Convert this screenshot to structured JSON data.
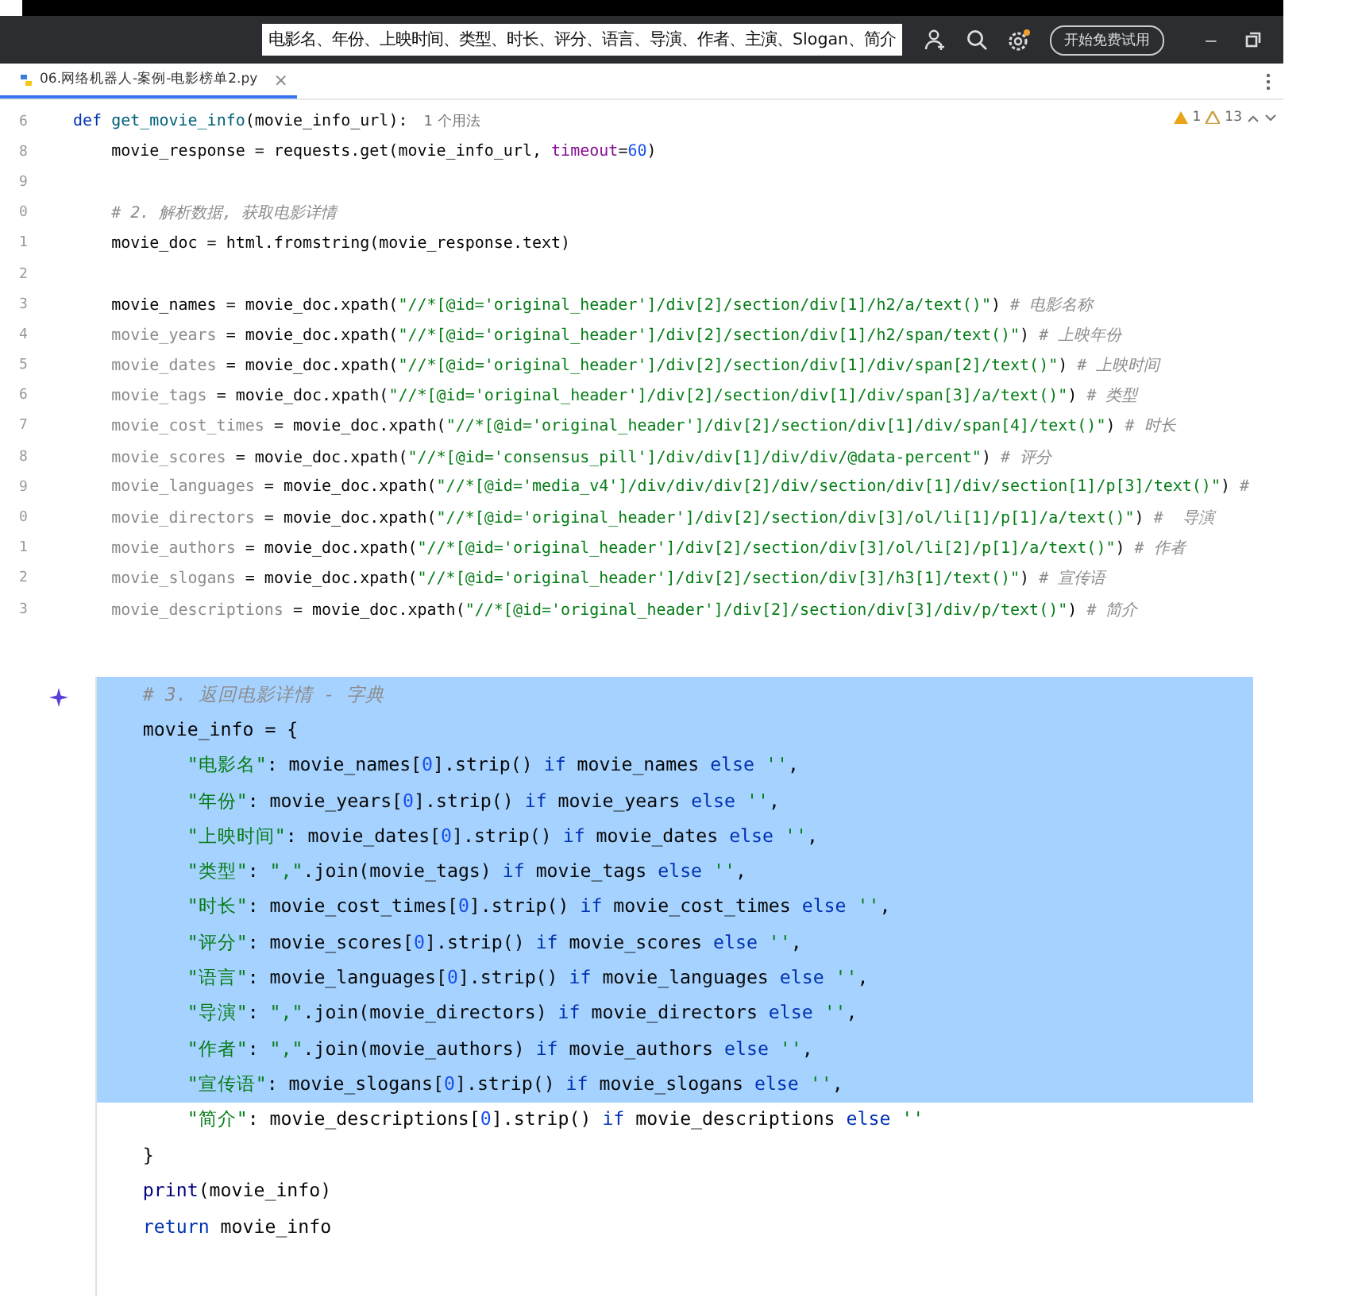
{
  "title_bar": {
    "search_text": "电影名、年份、上映时间、类型、时长、评分、语言、导演、作者、主演、Slogan、简介",
    "trial_button": "开始免费试用",
    "minimize": "–"
  },
  "tab": {
    "title": "06.网络机器人-案例-电影榜单2.py",
    "close": "×",
    "selected": true
  },
  "inspections": {
    "warnings": "1",
    "weak_warnings": "13"
  },
  "editor_top": {
    "lines": [
      {
        "number": "6",
        "tokens": [
          {
            "kind": "kw",
            "text": "def "
          },
          {
            "kind": "fn",
            "text": "get_movie_info"
          },
          {
            "kind": "plain",
            "text": "(movie_info_url):"
          },
          {
            "kind": "hint",
            "text": "1 个用法"
          }
        ]
      },
      {
        "number": "8",
        "tokens": [
          {
            "kind": "plain",
            "text": "    movie_response = requests.get(movie_info_url, "
          },
          {
            "kind": "param",
            "text": "timeout"
          },
          {
            "kind": "plain",
            "text": "="
          },
          {
            "kind": "num",
            "text": "60"
          },
          {
            "kind": "plain",
            "text": ")"
          }
        ]
      },
      {
        "number": "9"
      },
      {
        "number": "0",
        "tokens": [
          {
            "kind": "cm",
            "text": "    # 2. 解析数据, 获取电影详情"
          }
        ]
      },
      {
        "number": "1",
        "tokens": [
          {
            "kind": "plain",
            "text": "    movie_doc = html.fromstring(movie_response.text)"
          }
        ]
      },
      {
        "number": "2"
      },
      {
        "number": "3",
        "tokens": [
          {
            "kind": "plain",
            "text": "    movie_names = movie_doc.xpath("
          },
          {
            "kind": "str",
            "text": "\"//*[@id='original_header']/div[2]/section/div[1]/h2/a/text()\""
          },
          {
            "kind": "plain",
            "text": ") "
          },
          {
            "kind": "cm",
            "text": "# 电影名称"
          }
        ]
      },
      {
        "number": "4",
        "tokens": [
          {
            "kind": "dim",
            "text": "    movie_years"
          },
          {
            "kind": "plain",
            "text": " = movie_doc.xpath("
          },
          {
            "kind": "str",
            "text": "\"//*[@id='original_header']/div[2]/section/div[1]/h2/span/text()\""
          },
          {
            "kind": "plain",
            "text": ") "
          },
          {
            "kind": "cm",
            "text": "# 上映年份"
          }
        ]
      },
      {
        "number": "5",
        "tokens": [
          {
            "kind": "dim",
            "text": "    movie_dates"
          },
          {
            "kind": "plain",
            "text": " = movie_doc.xpath("
          },
          {
            "kind": "str",
            "text": "\"//*[@id='original_header']/div[2]/section/div[1]/div/span[2]/text()\""
          },
          {
            "kind": "plain",
            "text": ") "
          },
          {
            "kind": "cm",
            "text": "# 上映时间"
          }
        ]
      },
      {
        "number": "6",
        "tokens": [
          {
            "kind": "dim",
            "text": "    movie_tags"
          },
          {
            "kind": "plain",
            "text": " = movie_doc.xpath("
          },
          {
            "kind": "str",
            "text": "\"//*[@id='original_header']/div[2]/section/div[1]/div/span[3]/a/text()\""
          },
          {
            "kind": "plain",
            "text": ") "
          },
          {
            "kind": "cm",
            "text": "# 类型"
          }
        ]
      },
      {
        "number": "7",
        "tokens": [
          {
            "kind": "dim",
            "text": "    movie_cost_times"
          },
          {
            "kind": "plain",
            "text": " = movie_doc.xpath("
          },
          {
            "kind": "str",
            "text": "\"//*[@id='original_header']/div[2]/section/div[1]/div/span[4]/text()\""
          },
          {
            "kind": "plain",
            "text": ") "
          },
          {
            "kind": "cm",
            "text": "# 时长"
          }
        ]
      },
      {
        "number": "8",
        "tokens": [
          {
            "kind": "dim",
            "text": "    movie_scores"
          },
          {
            "kind": "plain",
            "text": " = movie_doc.xpath("
          },
          {
            "kind": "str",
            "text": "\"//*[@id='consensus_pill']/div/div[1]/div/div/@data-percent\""
          },
          {
            "kind": "plain",
            "text": ") "
          },
          {
            "kind": "cm",
            "text": "# 评分"
          }
        ]
      },
      {
        "number": "9",
        "tokens": [
          {
            "kind": "dim",
            "text": "    movie_languages"
          },
          {
            "kind": "plain",
            "text": " = movie_doc.xpath("
          },
          {
            "kind": "str",
            "text": "\"//*[@id='media_v4']/div/div/div[2]/div/section/div[1]/div/section[1]/p[3]/text()\""
          },
          {
            "kind": "plain",
            "text": ") "
          },
          {
            "kind": "cm",
            "text": "#"
          }
        ]
      },
      {
        "number": "0",
        "tokens": [
          {
            "kind": "dim",
            "text": "    movie_directors"
          },
          {
            "kind": "plain",
            "text": " = movie_doc.xpath("
          },
          {
            "kind": "str",
            "text": "\"//*[@id='original_header']/div[2]/section/div[3]/ol/li[1]/p[1]/a/text()\""
          },
          {
            "kind": "plain",
            "text": ") "
          },
          {
            "kind": "cm",
            "text": "#  导演"
          }
        ]
      },
      {
        "number": "1",
        "tokens": [
          {
            "kind": "dim",
            "text": "    movie_authors"
          },
          {
            "kind": "plain",
            "text": " = movie_doc.xpath("
          },
          {
            "kind": "str",
            "text": "\"//*[@id='original_header']/div[2]/section/div[3]/ol/li[2]/p[1]/a/text()\""
          },
          {
            "kind": "plain",
            "text": ") "
          },
          {
            "kind": "cm",
            "text": "# 作者"
          }
        ]
      },
      {
        "number": "2",
        "tokens": [
          {
            "kind": "dim",
            "text": "    movie_slogans"
          },
          {
            "kind": "plain",
            "text": " = movie_doc.xpath("
          },
          {
            "kind": "str",
            "text": "\"//*[@id='original_header']/div[2]/section/div[3]/h3[1]/text()\""
          },
          {
            "kind": "plain",
            "text": ") "
          },
          {
            "kind": "cm",
            "text": "# 宣传语"
          }
        ]
      },
      {
        "number": "3",
        "tokens": [
          {
            "kind": "dim",
            "text": "    movie_descriptions"
          },
          {
            "kind": "plain",
            "text": " = movie_doc.xpath("
          },
          {
            "kind": "str",
            "text": "\"//*[@id='original_header']/div[2]/section/div[3]/div/p/text()\""
          },
          {
            "kind": "plain",
            "text": ") "
          },
          {
            "kind": "cm",
            "text": "# 简介"
          }
        ]
      }
    ]
  },
  "editor_bottom": {
    "lines": [
      {
        "selected": true,
        "tokens": [
          {
            "kind": "cm",
            "text": "    # 3. 返回电影详情 - 字典"
          }
        ]
      },
      {
        "selected": true,
        "tokens": [
          {
            "kind": "plain",
            "text": "    movie_info = {"
          }
        ]
      },
      {
        "selected": true,
        "tokens": [
          {
            "kind": "str",
            "text": "        \"电影名\""
          },
          {
            "kind": "plain",
            "text": ": movie_names["
          },
          {
            "kind": "num",
            "text": "0"
          },
          {
            "kind": "plain",
            "text": "].strip() "
          },
          {
            "kind": "kw",
            "text": "if"
          },
          {
            "kind": "plain",
            "text": " movie_names "
          },
          {
            "kind": "kw",
            "text": "else"
          },
          {
            "kind": "str",
            "text": " ''"
          },
          {
            "kind": "plain",
            "text": ","
          }
        ]
      },
      {
        "selected": true,
        "tokens": [
          {
            "kind": "str",
            "text": "        \"年份\""
          },
          {
            "kind": "plain",
            "text": ": movie_years["
          },
          {
            "kind": "num",
            "text": "0"
          },
          {
            "kind": "plain",
            "text": "].strip() "
          },
          {
            "kind": "kw",
            "text": "if"
          },
          {
            "kind": "plain",
            "text": " movie_years "
          },
          {
            "kind": "kw",
            "text": "else"
          },
          {
            "kind": "str",
            "text": " ''"
          },
          {
            "kind": "plain",
            "text": ","
          }
        ]
      },
      {
        "selected": true,
        "tokens": [
          {
            "kind": "str",
            "text": "        \"上映时间\""
          },
          {
            "kind": "plain",
            "text": ": movie_dates["
          },
          {
            "kind": "num",
            "text": "0"
          },
          {
            "kind": "plain",
            "text": "].strip() "
          },
          {
            "kind": "kw",
            "text": "if"
          },
          {
            "kind": "plain",
            "text": " movie_dates "
          },
          {
            "kind": "kw",
            "text": "else"
          },
          {
            "kind": "str",
            "text": " ''"
          },
          {
            "kind": "plain",
            "text": ","
          }
        ]
      },
      {
        "selected": true,
        "tokens": [
          {
            "kind": "str",
            "text": "        \"类型\""
          },
          {
            "kind": "plain",
            "text": ": "
          },
          {
            "kind": "str",
            "text": "\",\""
          },
          {
            "kind": "plain",
            "text": ".join(movie_tags) "
          },
          {
            "kind": "kw",
            "text": "if"
          },
          {
            "kind": "plain",
            "text": " movie_tags "
          },
          {
            "kind": "kw",
            "text": "else"
          },
          {
            "kind": "str",
            "text": " ''"
          },
          {
            "kind": "plain",
            "text": ","
          }
        ]
      },
      {
        "selected": true,
        "tokens": [
          {
            "kind": "str",
            "text": "        \"时长\""
          },
          {
            "kind": "plain",
            "text": ": movie_cost_times["
          },
          {
            "kind": "num",
            "text": "0"
          },
          {
            "kind": "plain",
            "text": "].strip() "
          },
          {
            "kind": "kw",
            "text": "if"
          },
          {
            "kind": "plain",
            "text": " movie_cost_times "
          },
          {
            "kind": "kw",
            "text": "else"
          },
          {
            "kind": "str",
            "text": " ''"
          },
          {
            "kind": "plain",
            "text": ","
          }
        ]
      },
      {
        "selected": true,
        "tokens": [
          {
            "kind": "str",
            "text": "        \"评分\""
          },
          {
            "kind": "plain",
            "text": ": movie_scores["
          },
          {
            "kind": "num",
            "text": "0"
          },
          {
            "kind": "plain",
            "text": "].strip() "
          },
          {
            "kind": "kw",
            "text": "if"
          },
          {
            "kind": "plain",
            "text": " movie_scores "
          },
          {
            "kind": "kw",
            "text": "else"
          },
          {
            "kind": "str",
            "text": " ''"
          },
          {
            "kind": "plain",
            "text": ","
          }
        ]
      },
      {
        "selected": true,
        "tokens": [
          {
            "kind": "str",
            "text": "        \"语言\""
          },
          {
            "kind": "plain",
            "text": ": movie_languages["
          },
          {
            "kind": "num",
            "text": "0"
          },
          {
            "kind": "plain",
            "text": "].strip() "
          },
          {
            "kind": "kw",
            "text": "if"
          },
          {
            "kind": "plain",
            "text": " movie_languages "
          },
          {
            "kind": "kw",
            "text": "else"
          },
          {
            "kind": "str",
            "text": " ''"
          },
          {
            "kind": "plain",
            "text": ","
          }
        ]
      },
      {
        "selected": true,
        "tokens": [
          {
            "kind": "str",
            "text": "        \"导演\""
          },
          {
            "kind": "plain",
            "text": ": "
          },
          {
            "kind": "str",
            "text": "\",\""
          },
          {
            "kind": "plain",
            "text": ".join(movie_directors) "
          },
          {
            "kind": "kw",
            "text": "if"
          },
          {
            "kind": "plain",
            "text": " movie_directors "
          },
          {
            "kind": "kw",
            "text": "else"
          },
          {
            "kind": "str",
            "text": " ''"
          },
          {
            "kind": "plain",
            "text": ","
          }
        ]
      },
      {
        "selected": true,
        "tokens": [
          {
            "kind": "str",
            "text": "        \"作者\""
          },
          {
            "kind": "plain",
            "text": ": "
          },
          {
            "kind": "str",
            "text": "\",\""
          },
          {
            "kind": "plain",
            "text": ".join(movie_authors) "
          },
          {
            "kind": "kw",
            "text": "if"
          },
          {
            "kind": "plain",
            "text": " movie_authors "
          },
          {
            "kind": "kw",
            "text": "else"
          },
          {
            "kind": "str",
            "text": " ''"
          },
          {
            "kind": "plain",
            "text": ","
          }
        ]
      },
      {
        "selected": true,
        "tokens": [
          {
            "kind": "str",
            "text": "        \"宣传语\""
          },
          {
            "kind": "plain",
            "text": ": movie_slogans["
          },
          {
            "kind": "num",
            "text": "0"
          },
          {
            "kind": "plain",
            "text": "].strip() "
          },
          {
            "kind": "kw",
            "text": "if"
          },
          {
            "kind": "plain",
            "text": " movie_slogans "
          },
          {
            "kind": "kw",
            "text": "else"
          },
          {
            "kind": "str",
            "text": " ''"
          },
          {
            "kind": "plain",
            "text": ","
          }
        ]
      },
      {
        "selected": false,
        "tokens": [
          {
            "kind": "str",
            "text": "        \"简介\""
          },
          {
            "kind": "plain",
            "text": ": movie_descriptions["
          },
          {
            "kind": "num",
            "text": "0"
          },
          {
            "kind": "plain",
            "text": "].strip() "
          },
          {
            "kind": "kw",
            "text": "if"
          },
          {
            "kind": "plain",
            "text": " movie_descriptions "
          },
          {
            "kind": "kw",
            "text": "else"
          },
          {
            "kind": "str",
            "text": " ''"
          }
        ]
      },
      {
        "selected": false,
        "tokens": [
          {
            "kind": "plain",
            "text": "    }"
          }
        ]
      },
      {
        "selected": false,
        "tokens": [
          {
            "kind": "builtin",
            "text": "    print"
          },
          {
            "kind": "plain",
            "text": "(movie_info)"
          }
        ]
      },
      {
        "selected": false,
        "tokens": [
          {
            "kind": "kw",
            "text": "    return"
          },
          {
            "kind": "plain",
            "text": " movie_info"
          }
        ]
      }
    ]
  }
}
